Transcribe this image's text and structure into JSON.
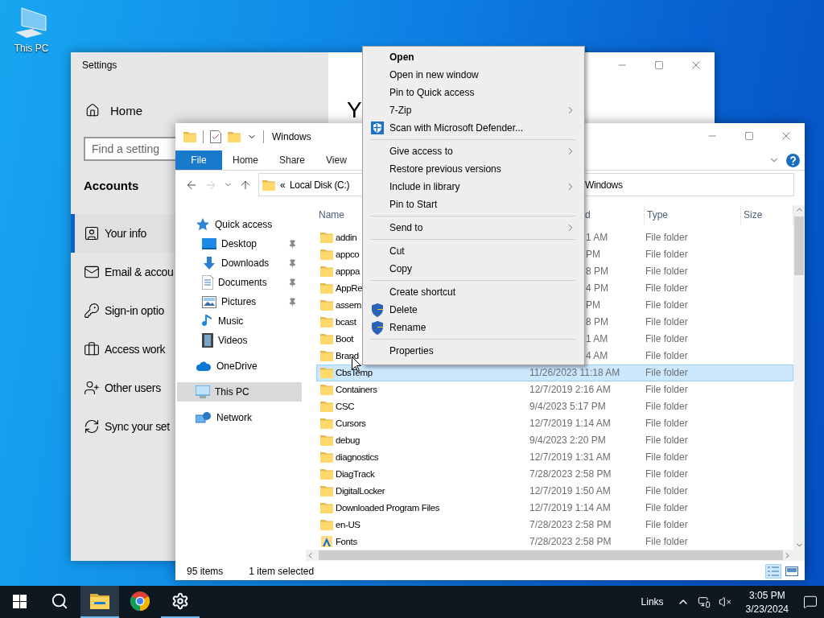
{
  "desktop": {
    "icons": [
      {
        "label": "This PC"
      }
    ]
  },
  "settings": {
    "title": "Settings",
    "home": "Home",
    "search": {
      "placeholder": "Find a setting"
    },
    "section": "Accounts",
    "heading": "Y",
    "nav": [
      {
        "label": "Your info",
        "kind": "person",
        "selected": true
      },
      {
        "label": "Email & accou",
        "kind": "mail",
        "selected": false
      },
      {
        "label": "Sign-in optio",
        "kind": "key",
        "selected": false
      },
      {
        "label": "Access work",
        "kind": "briefcase",
        "selected": false
      },
      {
        "label": "Other users",
        "kind": "user-plus",
        "selected": false
      },
      {
        "label": "Sync your set",
        "kind": "sync",
        "selected": false
      }
    ]
  },
  "explorer": {
    "title": "Windows",
    "ribbon_tabs": [
      {
        "label": "File",
        "selected": true
      },
      {
        "label": "Home",
        "selected": false
      },
      {
        "label": "Share",
        "selected": false
      },
      {
        "label": "View",
        "selected": false
      }
    ],
    "address": {
      "overflow_mark": "«",
      "crumbs": [
        "Local Disk (C:)",
        "Windows"
      ]
    },
    "nav_pane": [
      {
        "label": "Quick access",
        "kind": "star",
        "selected": false,
        "children": [
          {
            "label": "Desktop",
            "kind": "desktop",
            "pinned": true,
            "selected": false
          },
          {
            "label": "Downloads",
            "kind": "downloads",
            "pinned": true,
            "selected": false
          },
          {
            "label": "Documents",
            "kind": "documents",
            "pinned": true,
            "selected": false
          },
          {
            "label": "Pictures",
            "kind": "pictures",
            "pinned": true,
            "selected": false
          },
          {
            "label": "Music",
            "kind": "music",
            "pinned": false,
            "selected": false
          },
          {
            "label": "Videos",
            "kind": "videos",
            "pinned": false,
            "selected": false
          }
        ]
      },
      {
        "label": "OneDrive",
        "kind": "cloud",
        "selected": false
      },
      {
        "label": "This PC",
        "kind": "pc",
        "selected": true
      },
      {
        "label": "Network",
        "kind": "network",
        "selected": false
      }
    ],
    "columns": [
      {
        "label": "Name",
        "covered": false
      },
      {
        "label": "d",
        "covered": true
      },
      {
        "label": "Type",
        "covered": false
      },
      {
        "label": "Size",
        "covered": false
      }
    ],
    "rows": [
      {
        "name": "addin",
        "date": "1 AM",
        "type": "File folder",
        "kind": "folder",
        "covered": true,
        "selected": false
      },
      {
        "name": "appco",
        "date": "PM",
        "type": "File folder",
        "kind": "folder",
        "covered": true,
        "selected": false
      },
      {
        "name": "apppa",
        "date": "8 PM",
        "type": "File folder",
        "kind": "folder",
        "covered": true,
        "selected": false
      },
      {
        "name": "AppRe",
        "date": "4 PM",
        "type": "File folder",
        "kind": "folder",
        "covered": true,
        "selected": false
      },
      {
        "name": "assem",
        "date": "PM",
        "type": "File folder",
        "kind": "folder",
        "covered": true,
        "selected": false
      },
      {
        "name": "bcast",
        "date": "8 PM",
        "type": "File folder",
        "kind": "folder",
        "covered": true,
        "selected": false
      },
      {
        "name": "Boot",
        "date": "1 AM",
        "type": "File folder",
        "kind": "folder",
        "covered": true,
        "selected": false
      },
      {
        "name": "Brand",
        "date": "4 AM",
        "type": "File folder",
        "kind": "folder",
        "covered": true,
        "selected": false
      },
      {
        "name": "CbsTemp",
        "date": "11/26/2023 11:18 AM",
        "type": "File folder",
        "kind": "folder",
        "covered": false,
        "selected": true
      },
      {
        "name": "Containers",
        "date": "12/7/2019 2:16 AM",
        "type": "File folder",
        "kind": "folder",
        "covered": false,
        "selected": false
      },
      {
        "name": "CSC",
        "date": "9/4/2023 5:17 PM",
        "type": "File folder",
        "kind": "folder",
        "covered": false,
        "selected": false
      },
      {
        "name": "Cursors",
        "date": "12/7/2019 1:14 AM",
        "type": "File folder",
        "kind": "folder",
        "covered": false,
        "selected": false
      },
      {
        "name": "debug",
        "date": "9/4/2023 2:20 PM",
        "type": "File folder",
        "kind": "folder",
        "covered": false,
        "selected": false
      },
      {
        "name": "diagnostics",
        "date": "12/7/2019 1:31 AM",
        "type": "File folder",
        "kind": "folder",
        "covered": false,
        "selected": false
      },
      {
        "name": "DiagTrack",
        "date": "7/28/2023 2:58 PM",
        "type": "File folder",
        "kind": "folder",
        "covered": false,
        "selected": false
      },
      {
        "name": "DigitalLocker",
        "date": "12/7/2019 1:50 AM",
        "type": "File folder",
        "kind": "folder",
        "covered": false,
        "selected": false
      },
      {
        "name": "Downloaded Program Files",
        "date": "12/7/2019 1:14 AM",
        "type": "File folder",
        "kind": "folder",
        "covered": false,
        "selected": false
      },
      {
        "name": "en-US",
        "date": "7/28/2023 2:58 PM",
        "type": "File folder",
        "kind": "folder",
        "covered": false,
        "selected": false
      },
      {
        "name": "Fonts",
        "date": "7/28/2023 2:58 PM",
        "type": "File folder",
        "kind": "font",
        "covered": false,
        "selected": false
      }
    ],
    "status": {
      "count": "95 items",
      "selection": "1 item selected"
    }
  },
  "context_menu": [
    {
      "kind": "item",
      "label": "Open",
      "default": true,
      "submenu": false,
      "defender": false,
      "shield": false
    },
    {
      "kind": "item",
      "label": "Open in new window",
      "default": false,
      "submenu": false,
      "defender": false,
      "shield": false
    },
    {
      "kind": "item",
      "label": "Pin to Quick access",
      "default": false,
      "submenu": false,
      "defender": false,
      "shield": false
    },
    {
      "kind": "item",
      "label": "7-Zip",
      "default": false,
      "submenu": true,
      "defender": false,
      "shield": false
    },
    {
      "kind": "item",
      "label": "Scan with Microsoft Defender...",
      "default": false,
      "submenu": false,
      "defender": true,
      "shield": false
    },
    {
      "kind": "separator"
    },
    {
      "kind": "item",
      "label": "Give access to",
      "default": false,
      "submenu": true,
      "defender": false,
      "shield": false
    },
    {
      "kind": "item",
      "label": "Restore previous versions",
      "default": false,
      "submenu": false,
      "defender": false,
      "shield": false
    },
    {
      "kind": "item",
      "label": "Include in library",
      "default": false,
      "submenu": true,
      "defender": false,
      "shield": false
    },
    {
      "kind": "item",
      "label": "Pin to Start",
      "default": false,
      "submenu": false,
      "defender": false,
      "shield": false
    },
    {
      "kind": "separator"
    },
    {
      "kind": "item",
      "label": "Send to",
      "default": false,
      "submenu": true,
      "defender": false,
      "shield": false
    },
    {
      "kind": "separator"
    },
    {
      "kind": "item",
      "label": "Cut",
      "default": false,
      "submenu": false,
      "defender": false,
      "shield": false
    },
    {
      "kind": "item",
      "label": "Copy",
      "default": false,
      "submenu": false,
      "defender": false,
      "shield": false
    },
    {
      "kind": "separator"
    },
    {
      "kind": "item",
      "label": "Create shortcut",
      "default": false,
      "submenu": false,
      "defender": false,
      "shield": false
    },
    {
      "kind": "item",
      "label": "Delete",
      "default": false,
      "submenu": false,
      "defender": false,
      "shield": true
    },
    {
      "kind": "item",
      "label": "Rename",
      "default": false,
      "submenu": false,
      "defender": false,
      "shield": true
    },
    {
      "kind": "separator"
    },
    {
      "kind": "item",
      "label": "Properties",
      "default": false,
      "submenu": false,
      "defender": false,
      "shield": false
    }
  ],
  "taskbar": {
    "apps": [
      {
        "kind": "start",
        "running": false,
        "active": false
      },
      {
        "kind": "search",
        "running": false,
        "active": false
      },
      {
        "kind": "explorer",
        "running": true,
        "active": true
      },
      {
        "kind": "chrome",
        "running": false,
        "active": false
      },
      {
        "kind": "settings",
        "running": true,
        "active": false
      }
    ],
    "tray": {
      "links": "Links",
      "time": "3:05 PM",
      "date": "3/23/2024"
    }
  }
}
